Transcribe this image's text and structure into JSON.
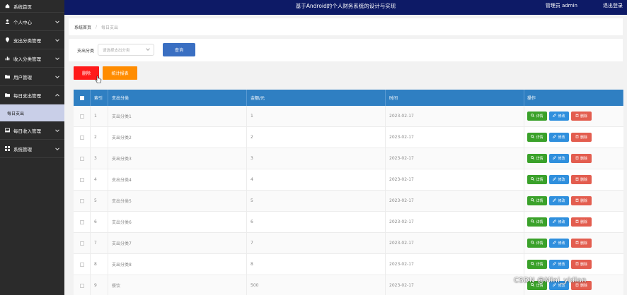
{
  "sidebar": {
    "items": [
      {
        "label": "系统首页",
        "icon": "home-icon",
        "expanded": false
      },
      {
        "label": "个人中心",
        "icon": "user-icon",
        "expanded": false
      },
      {
        "label": "支出分类管理",
        "icon": "pin-icon",
        "expanded": false
      },
      {
        "label": "收入分类管理",
        "icon": "chart-icon",
        "expanded": false
      },
      {
        "label": "用户管理",
        "icon": "folder-icon",
        "expanded": false
      },
      {
        "label": "每日支出管理",
        "icon": "folder-icon",
        "expanded": true,
        "sub": [
          "每日支出"
        ]
      },
      {
        "label": "每日收入管理",
        "icon": "image-icon",
        "expanded": false
      },
      {
        "label": "系统管理",
        "icon": "grid-icon",
        "expanded": false
      }
    ]
  },
  "header": {
    "title": "基于Android的个人财务系统的设计与实现",
    "user": "管理员 admin",
    "logout": "退出登录"
  },
  "breadcrumb": {
    "home": "系统首页",
    "sep": "/",
    "current": "每日支出"
  },
  "filter": {
    "label": "支出分类",
    "placeholder": "请选择支出分类",
    "query_label": "查询"
  },
  "actions": {
    "delete_label": "删除",
    "stats_label": "统计报表"
  },
  "table": {
    "headers": [
      "索引",
      "支出分类",
      "金额/元",
      "时间",
      "操作"
    ],
    "rows": [
      {
        "idx": "1",
        "cat": "支出分类1",
        "amt": "1",
        "time": "2023-02-17"
      },
      {
        "idx": "2",
        "cat": "支出分类2",
        "amt": "2",
        "time": "2023-02-17"
      },
      {
        "idx": "3",
        "cat": "支出分类3",
        "amt": "3",
        "time": "2023-02-17"
      },
      {
        "idx": "4",
        "cat": "支出分类4",
        "amt": "4",
        "time": "2023-02-17"
      },
      {
        "idx": "5",
        "cat": "支出分类5",
        "amt": "5",
        "time": "2023-02-17"
      },
      {
        "idx": "6",
        "cat": "支出分类6",
        "amt": "6",
        "time": "2023-02-17"
      },
      {
        "idx": "7",
        "cat": "支出分类7",
        "amt": "7",
        "time": "2023-02-17"
      },
      {
        "idx": "8",
        "cat": "支出分类8",
        "amt": "8",
        "time": "2023-02-17"
      },
      {
        "idx": "9",
        "cat": "餐饮",
        "amt": "500",
        "time": "2023-02-17"
      }
    ],
    "ops": {
      "detail": "详情",
      "edit": "修改",
      "delete": "删除"
    }
  },
  "watermark": "CSDN @Mini_yidian",
  "colors": {
    "topbar": "#0d1a66",
    "sidebar": "#2b2b2b",
    "thead": "#2f7fc2",
    "delete": "#ff1a1a",
    "stats": "#ff8c00",
    "query": "#3a6fc2"
  }
}
